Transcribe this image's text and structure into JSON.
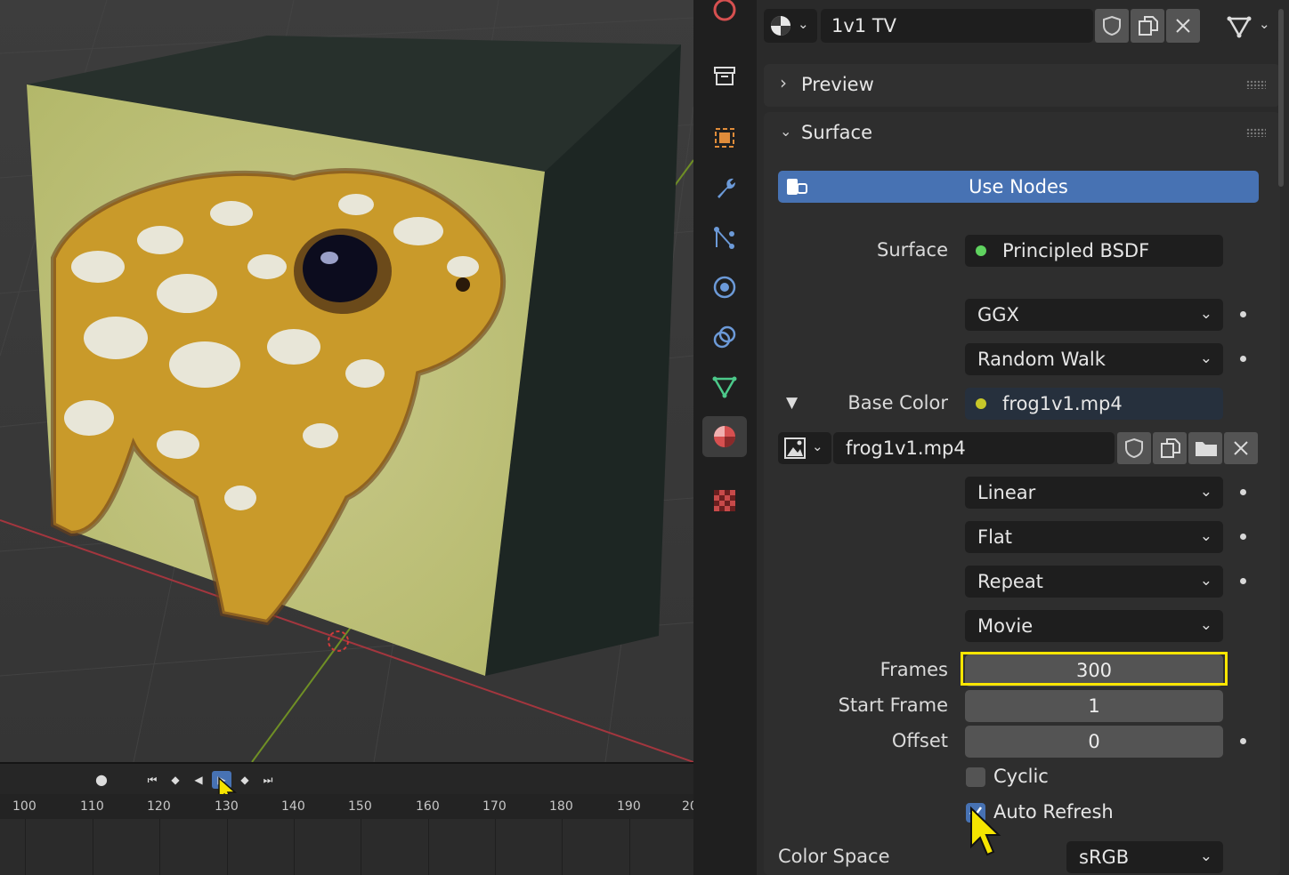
{
  "header": {
    "material_name": "1v1 TV"
  },
  "panels": {
    "preview_label": "Preview",
    "surface_label": "Surface",
    "use_nodes_label": "Use Nodes"
  },
  "surface": {
    "surface_label": "Surface",
    "surface_value": "Principled BSDF",
    "distribution": "GGX",
    "subsurface_method": "Random Walk",
    "base_color_label": "Base Color",
    "base_color_value": "frog1v1.mp4"
  },
  "image": {
    "name": "frog1v1.mp4",
    "interpolation": "Linear",
    "projection": "Flat",
    "extension": "Repeat",
    "source": "Movie",
    "frames_label": "Frames",
    "frames_value": "300",
    "start_frame_label": "Start Frame",
    "start_frame_value": "1",
    "offset_label": "Offset",
    "offset_value": "0",
    "cyclic_label": "Cyclic",
    "cyclic_checked": false,
    "auto_refresh_label": "Auto Refresh",
    "auto_refresh_checked": true,
    "color_space_label": "Color Space",
    "color_space_value": "sRGB"
  },
  "timeline": {
    "frame_numbers": [
      "100",
      "110",
      "120",
      "130",
      "140",
      "150",
      "160",
      "170",
      "180",
      "190",
      "20"
    ]
  },
  "colors": {
    "accent_blue": "#4772b3",
    "highlight_yellow": "#ffe600",
    "socket_green": "#5fd35f",
    "socket_yellow": "#c7c729"
  }
}
